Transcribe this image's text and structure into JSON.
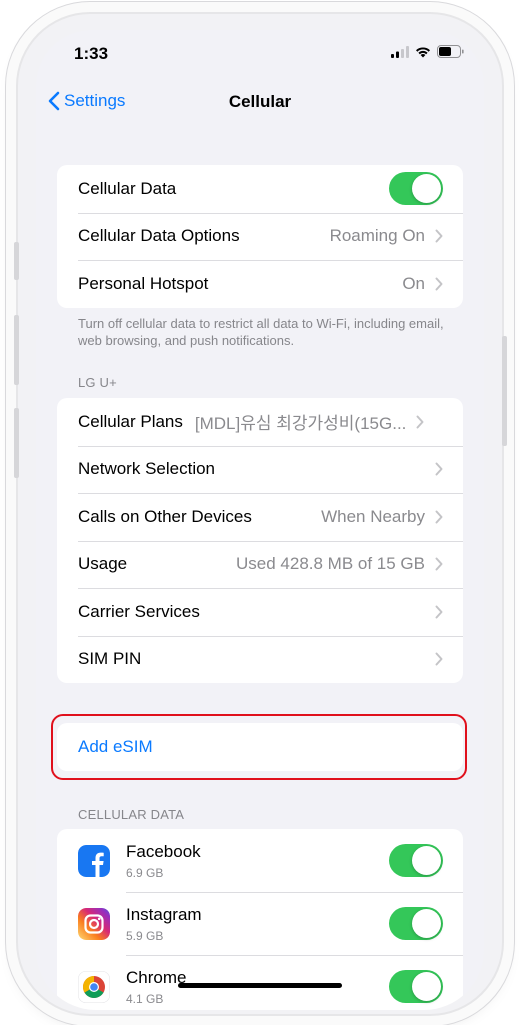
{
  "status_bar": {
    "time": "1:33"
  },
  "nav": {
    "back_label": "Settings",
    "title": "Cellular"
  },
  "group1": {
    "rows": [
      {
        "label": "Cellular Data",
        "toggle_on": true
      },
      {
        "label": "Cellular Data Options",
        "value": "Roaming On"
      },
      {
        "label": "Personal Hotspot",
        "value": "On"
      }
    ],
    "footer": "Turn off cellular data to restrict all data to Wi-Fi, including email, web browsing, and push notifications."
  },
  "carrier_header": "LG U+",
  "group2": {
    "rows": [
      {
        "label": "Cellular Plans",
        "value": "[MDL]유심 최강가성비(15G..."
      },
      {
        "label": "Network Selection",
        "value": ""
      },
      {
        "label": "Calls on Other Devices",
        "value": "When Nearby"
      },
      {
        "label": "Usage",
        "value": "Used 428.8 MB of 15 GB"
      },
      {
        "label": "Carrier Services",
        "value": ""
      },
      {
        "label": "SIM PIN",
        "value": ""
      }
    ]
  },
  "add_esim_label": "Add eSIM",
  "cellular_data_header": "CELLULAR DATA",
  "apps": [
    {
      "name": "Facebook",
      "size": "6.9 GB",
      "toggle_on": true,
      "icon": "facebook-icon"
    },
    {
      "name": "Instagram",
      "size": "5.9 GB",
      "toggle_on": true,
      "icon": "instagram-icon"
    },
    {
      "name": "Chrome",
      "size": "4.1 GB",
      "toggle_on": true,
      "icon": "chrome-icon"
    }
  ],
  "colors": {
    "accent": "#0a7aff",
    "toggle_on": "#34c759",
    "highlight": "#e0101c"
  }
}
